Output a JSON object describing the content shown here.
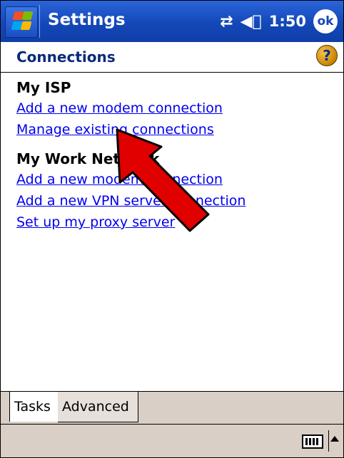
{
  "titlebar": {
    "app_title": "Settings",
    "time": "1:50",
    "ok_label": "ok",
    "connectivity_icon": "connectivity-icon",
    "volume_icon": "volume-icon"
  },
  "page": {
    "heading": "Connections",
    "help_label": "?"
  },
  "sections": [
    {
      "title": "My ISP",
      "links": [
        "Add a new modem connection",
        "Manage existing connections"
      ]
    },
    {
      "title": "My Work Network",
      "links": [
        "Add a new modem connection",
        "Add a new VPN server connection",
        "Set up my proxy server"
      ]
    }
  ],
  "tabs": [
    "Tasks",
    "Advanced"
  ],
  "colors": {
    "title_bar": "#1448b8",
    "link": "#0000ee",
    "heading": "#0a2a7a",
    "arrow": "#e10000"
  }
}
